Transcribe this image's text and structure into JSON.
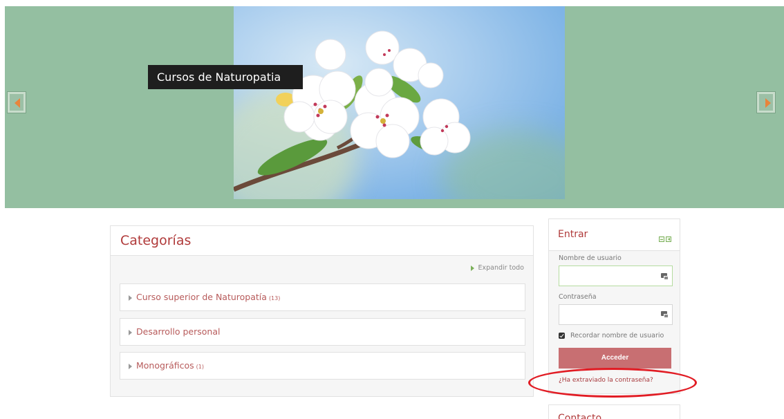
{
  "slider": {
    "caption": "Cursos de Naturopatia",
    "prev_icon": "arrow-left-icon",
    "next_icon": "arrow-right-icon"
  },
  "categories": {
    "title": "Categorías",
    "expand_all": "Expandir todo",
    "items": [
      {
        "label": "Curso superior de Naturopatía",
        "count": "(13)"
      },
      {
        "label": "Desarrollo personal",
        "count": ""
      },
      {
        "label": "Monográficos",
        "count": "(1)"
      }
    ]
  },
  "login": {
    "title": "Entrar",
    "username_label": "Nombre de usuario",
    "username_value": "",
    "password_label": "Contraseña",
    "password_value": "",
    "remember_label": "Recordar nombre de usuario",
    "remember_checked": true,
    "button_label": "Acceder",
    "forgot_link": "¿Ha extraviado la contraseña?"
  },
  "contact": {
    "title": "Contacto"
  },
  "colors": {
    "slider_bg": "#94bfa1",
    "accent": "#b03a3a",
    "button": "#c86f72",
    "highlight": "#e11c24"
  }
}
